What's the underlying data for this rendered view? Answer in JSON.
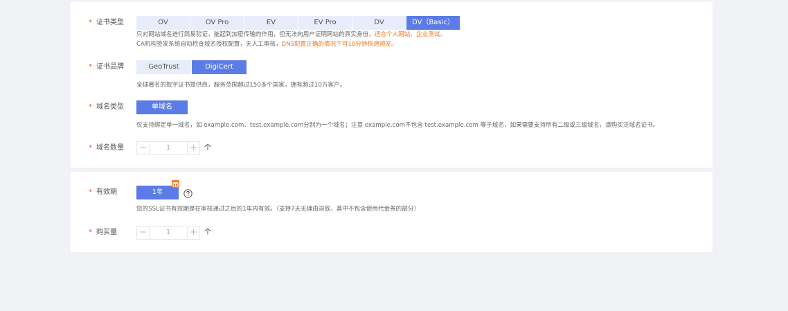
{
  "cert_type": {
    "label": "证书类型",
    "star": "*",
    "options": [
      "OV",
      "OV Pro",
      "EV",
      "EV Pro",
      "DV",
      "DV（Basic）"
    ],
    "selected_index": 5,
    "hint_line1_prefix": "只对网站域名进行简易验证，能起到加密传输的作用，但无法向用户证明网站的真实身份，",
    "hint_line1_highlight": "适合个人网站、企业测试。",
    "hint_line2_prefix": "CA机构签发系统自动检查域名授权配置，无人工审核，",
    "hint_line2_highlight": "DNS配置正确的情况下可10分钟快速颁发。"
  },
  "cert_brand": {
    "label": "证书品牌",
    "star": "*",
    "options": [
      "GeoTrust",
      "DigiCert"
    ],
    "selected_index": 1,
    "hint": "全球著名的数字证书提供商，服务范围超过150多个国家，拥有超过10万客户。"
  },
  "domain_type": {
    "label": "域名类型",
    "star": "*",
    "option": "单域名",
    "hint": "仅支持绑定单一域名，如 example.com、test.example.com分别为一个域名；注意 example.com不包含 test.example.com 等子域名，如果需要支持所有二级或三级域名，请购买泛域名证书。"
  },
  "domain_count": {
    "label": "域名数量",
    "star": "*",
    "minus": "−",
    "plus": "+",
    "value": "1",
    "unit": "个"
  },
  "validity": {
    "label": "有效期",
    "star": "*",
    "option": "1年",
    "hint": "您的SSL证书有效期是在审核通过之后的1年内有效。（支持7天无理由退款，其中不包含使用代金券的部分）",
    "colors": {
      "accent": "#5b7ce6",
      "badge": "#f07a22"
    }
  },
  "purchase_qty": {
    "label": "购买量",
    "star": "*",
    "minus": "−",
    "plus": "+",
    "value": "1",
    "unit": "个"
  }
}
